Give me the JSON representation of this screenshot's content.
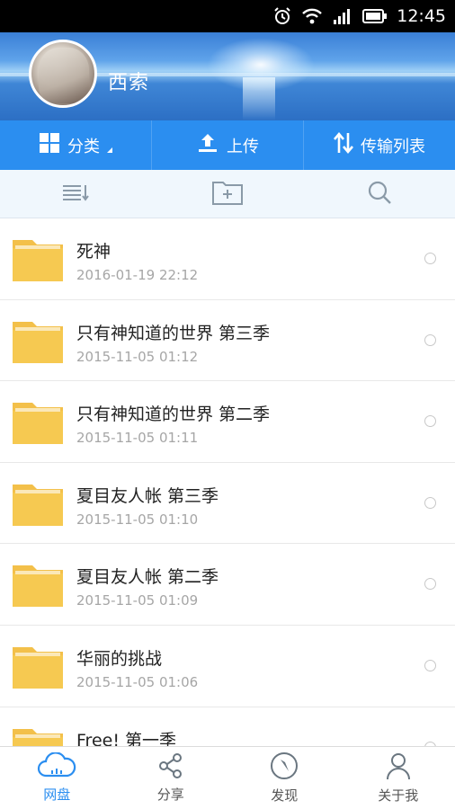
{
  "status_bar": {
    "time": "12:45",
    "icons": [
      "alarm-icon",
      "wifi-icon",
      "signal-icon",
      "battery-icon"
    ]
  },
  "profile": {
    "username": "西索"
  },
  "action_bar": {
    "category_label": "分类",
    "upload_label": "上传",
    "transfer_label": "传输列表"
  },
  "toolbar": {
    "icons": [
      "sort-icon",
      "new-folder-icon",
      "search-icon"
    ]
  },
  "files": [
    {
      "name": "死神",
      "date": "2016-01-19  22:12"
    },
    {
      "name": "只有神知道的世界 第三季",
      "date": "2015-11-05  01:12"
    },
    {
      "name": "只有神知道的世界 第二季",
      "date": "2015-11-05  01:11"
    },
    {
      "name": "夏目友人帐 第三季",
      "date": "2015-11-05  01:10"
    },
    {
      "name": "夏目友人帐 第二季",
      "date": "2015-11-05  01:09"
    },
    {
      "name": "华丽的挑战",
      "date": "2015-11-05  01:06"
    },
    {
      "name": "Free! 第一季",
      "date": ""
    }
  ],
  "bottom_nav": {
    "disk": "网盘",
    "share": "分享",
    "discover": "发现",
    "me": "关于我"
  },
  "colors": {
    "accent": "#2b8ef0",
    "folder": "#f5c54a",
    "statusbar": "#000000"
  }
}
